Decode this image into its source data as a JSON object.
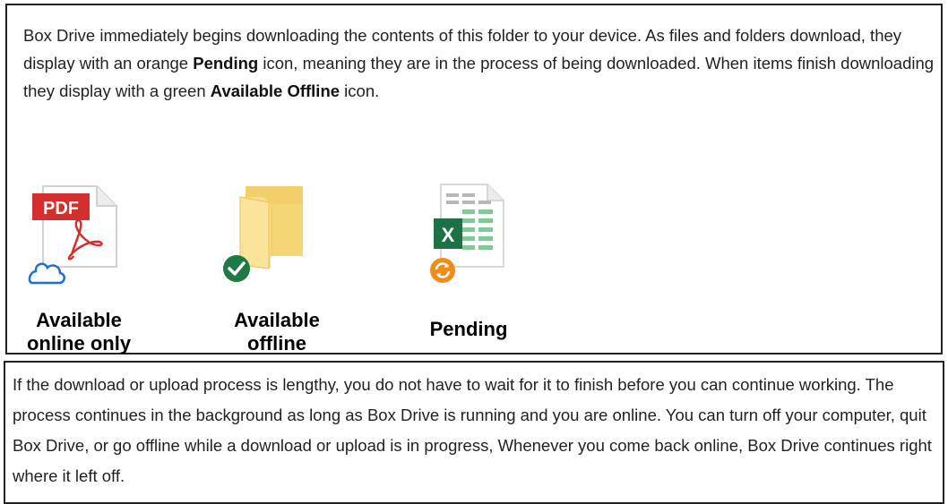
{
  "intro": {
    "part1": "Box Drive immediately begins downloading the contents of this folder to your device. As files and folders download, they display with an orange ",
    "bold1": "Pending",
    "part2": " icon, meaning they are in the process of being downloaded. When items finish downloading they display with a green ",
    "bold2": "Available Offline",
    "part3": " icon."
  },
  "icons": [
    {
      "name": "pdf-file-icon",
      "badge": "cloud-icon",
      "label_line1": "Available",
      "label_line2": "online only",
      "file_badge_text": "PDF"
    },
    {
      "name": "folder-icon",
      "badge": "green-check-icon",
      "label_line1": "Available",
      "label_line2": "offline"
    },
    {
      "name": "excel-file-icon",
      "badge": "orange-sync-icon",
      "label_line1": "Pending",
      "label_line2": "",
      "file_badge_text": "X"
    }
  ],
  "colors": {
    "pdf_red": "#d32f2f",
    "folder_yellow": "#f7d774",
    "excel_green": "#1e7145",
    "check_green": "#1e7a45",
    "sync_orange": "#f08c1a",
    "cloud_blue": "#1f6fd1"
  },
  "footer": {
    "text": "If the download or upload process is lengthy, you do not have to wait for it to finish before you can continue working. The process continues in the background as long as Box Drive is running and you are online. You can turn off your computer, quit Box Drive, or go offline while a download or upload is in progress, Whenever you come back online, Box Drive continues right where it left off."
  }
}
